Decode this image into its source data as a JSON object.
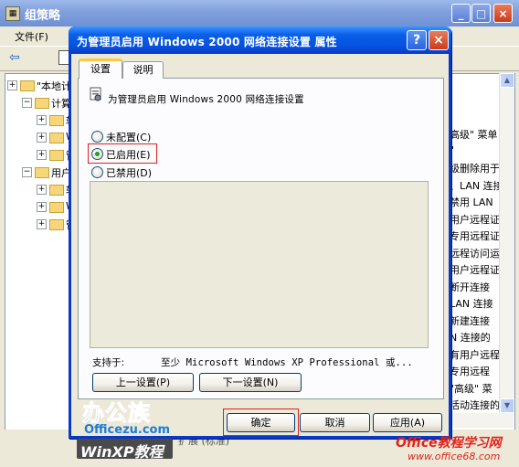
{
  "background_window": {
    "title": "组策略",
    "controls": {
      "minimize": "_",
      "maximize": "□",
      "close": "×"
    },
    "menu": {
      "file": "文件(F)"
    },
    "tree": [
      {
        "label": "\"本地计",
        "indent": 0
      },
      {
        "label": "计算",
        "indent": 1
      },
      {
        "label": "软",
        "indent": 2
      },
      {
        "label": "Wi",
        "indent": 2
      },
      {
        "label": "管",
        "indent": 2
      },
      {
        "label": "用户",
        "indent": 1
      },
      {
        "label": "软",
        "indent": 2
      },
      {
        "label": "Wi",
        "indent": 2
      },
      {
        "label": "管",
        "indent": 2
      }
    ],
    "right_lines": [
      "高级\" 菜单",
      "\"",
      "级删除用于",
      "、LAN 连接",
      "禁用 LAN",
      "用户远程证",
      "专用远程证",
      "远程访问运",
      "用户远程证",
      "断开连接",
      "LAN 连接",
      "新建连接",
      "N 连接的",
      "有用户远程",
      "专用远程",
      "\"高级\" 菜",
      "活动连接的",
      "启用 Windo",
      "以或无连接"
    ],
    "status_text": "扩展 (标准)"
  },
  "dialog": {
    "title": "为管理员启用 Windows 2000 网络连接设置 属性",
    "help_label": "?",
    "close_label": "×",
    "tabs": [
      {
        "label": "设置",
        "active": true
      },
      {
        "label": "说明",
        "active": false
      }
    ],
    "heading": "为管理员启用 Windows 2000 网络连接设置",
    "options": {
      "not_configured": "未配置(C)",
      "enabled": "已启用(E)",
      "disabled": "已禁用(D)",
      "selected": "enabled"
    },
    "supported_on_label": "支持于:",
    "supported_on_value": "至少 Microsoft Windows XP Professional 或...",
    "buttons": {
      "previous": "上一设置(P)",
      "next": "下一设置(N)",
      "ok": "确定",
      "cancel": "取消",
      "apply": "应用(A)"
    }
  },
  "watermarks": {
    "left_logo": "办公族",
    "left_domain": "Officezu.com",
    "left_bottom": "WinXP教程",
    "right_title": "Office教程学习网",
    "right_url": "www.office68.com"
  },
  "colors": {
    "title_blue": "#0a5fe8",
    "highlight_red": "#e0201a",
    "dialog_face": "#ece9d8",
    "radio_dot": "#21a121"
  }
}
